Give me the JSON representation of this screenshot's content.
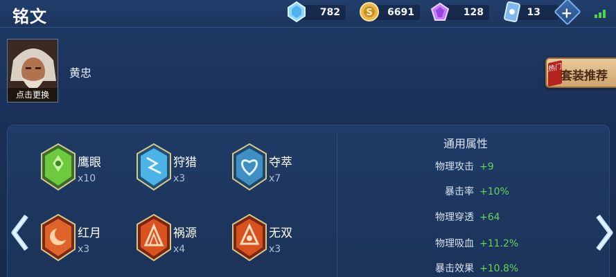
{
  "title": "铭文",
  "resources": [
    {
      "icon": "diamond-icon",
      "value": "782"
    },
    {
      "icon": "gold-coin-icon",
      "value": "6691"
    },
    {
      "icon": "purple-gem-icon",
      "value": "128"
    },
    {
      "icon": "coupon-card-icon",
      "value": "13"
    }
  ],
  "hero": {
    "name": "黄忠",
    "change_label": "点击更换"
  },
  "recommend": {
    "hot_badge": "热门",
    "label": "套装推荐"
  },
  "runes": [
    {
      "name": "鹰眼",
      "count": "x10",
      "color": "#5bb33a"
    },
    {
      "name": "狩猎",
      "count": "x3",
      "color": "#3aa7d8"
    },
    {
      "name": "夺萃",
      "count": "x7",
      "color": "#3d8fc9"
    },
    {
      "name": "红月",
      "count": "x3",
      "color": "#d9541e"
    },
    {
      "name": "祸源",
      "count": "x4",
      "color": "#d8461f"
    },
    {
      "name": "无双",
      "count": "x3",
      "color": "#cf4a1f"
    }
  ],
  "attributes": {
    "title": "通用属性",
    "items": [
      {
        "name": "物理攻击",
        "value": "+9"
      },
      {
        "name": "暴击率",
        "value": "+10%"
      },
      {
        "name": "物理穿透",
        "value": "+64"
      },
      {
        "name": "物理吸血",
        "value": "+11.2%"
      },
      {
        "name": "暴击效果",
        "value": "+10.8%"
      }
    ]
  },
  "colors": {
    "accent_green": "#6ad35a",
    "gold_button": "#d1a56e",
    "hot_red": "#b3241c"
  }
}
